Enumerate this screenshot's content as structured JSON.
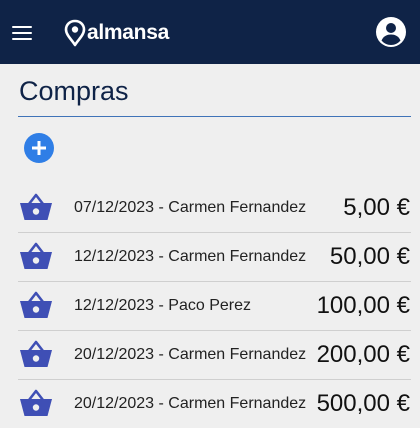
{
  "header": {
    "menu_icon": "hamburger-menu-icon",
    "logo_text": "almansa",
    "logo_icon": "map-pin-logo-icon",
    "account_icon": "account-circle-icon",
    "bar_color": "#0f2347"
  },
  "page": {
    "title": "Compras",
    "add_icon": "plus-icon",
    "accent_color": "#2f7ee6"
  },
  "purchases": [
    {
      "label": "07/12/2023 - Carmen Fernandez",
      "amount": "5,00 €"
    },
    {
      "label": "12/12/2023 - Carmen Fernandez",
      "amount": "50,00 €"
    },
    {
      "label": "12/12/2023 - Paco Perez",
      "amount": "100,00 €"
    },
    {
      "label": "20/12/2023 - Carmen Fernandez",
      "amount": "200,00 €"
    },
    {
      "label": "20/12/2023 - Carmen Fernandez",
      "amount": "500,00 €"
    }
  ],
  "row_icon": "shopping-basket-icon",
  "row_icon_color": "#3f4fb5"
}
